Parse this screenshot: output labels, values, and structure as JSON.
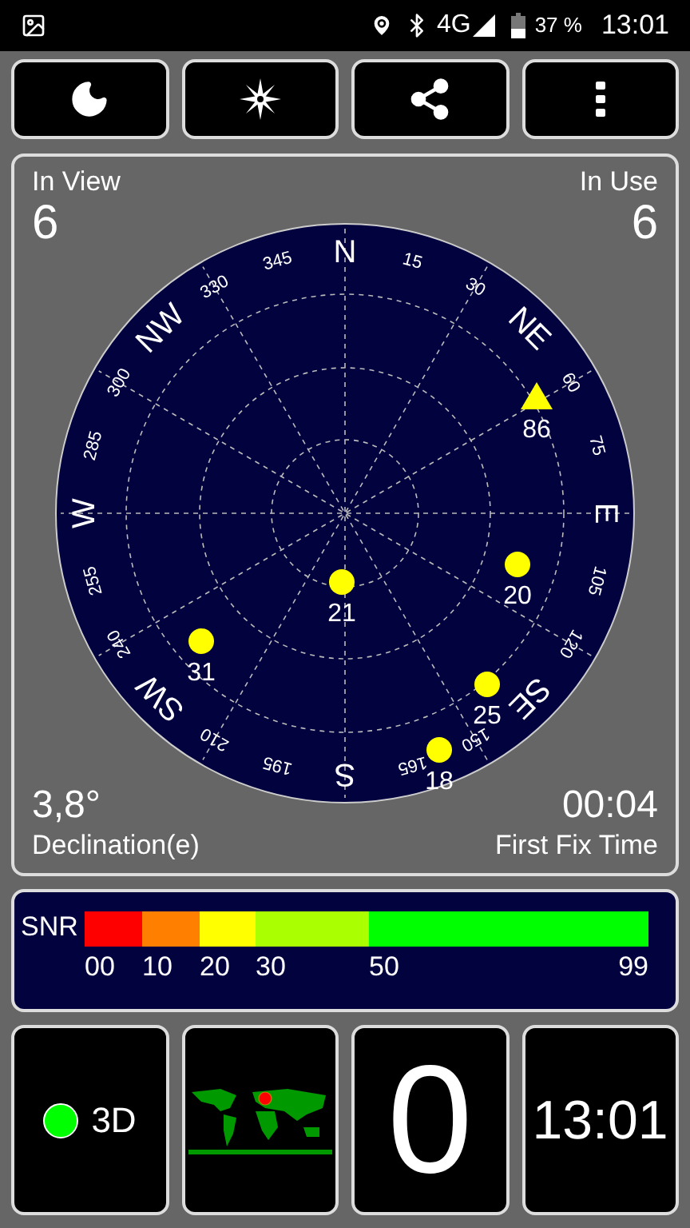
{
  "status_bar": {
    "network": "4G",
    "battery": "37 %",
    "time": "13:01"
  },
  "sky": {
    "in_view_label": "In View",
    "in_view": "6",
    "in_use_label": "In Use",
    "in_use": "6",
    "declination": "3,8°",
    "declination_label": "Declination(e)",
    "fix_time": "00:04",
    "fix_time_label": "First Fix Time",
    "compass": [
      "N",
      "NE",
      "E",
      "SE",
      "S",
      "SW",
      "W",
      "NW"
    ],
    "degrees": [
      "15",
      "30",
      "60",
      "75",
      "105",
      "120",
      "150",
      "165",
      "195",
      "210",
      "240",
      "255",
      "285",
      "300",
      "330",
      "345"
    ],
    "satellites": [
      {
        "id": "86",
        "kind": "triangle"
      },
      {
        "id": "20",
        "kind": "circle"
      },
      {
        "id": "21",
        "kind": "circle"
      },
      {
        "id": "31",
        "kind": "circle"
      },
      {
        "id": "25",
        "kind": "circle"
      },
      {
        "id": "18",
        "kind": "circle"
      }
    ]
  },
  "snr": {
    "label": "SNR",
    "segments": [
      {
        "label": "00",
        "color": "#ff0000"
      },
      {
        "label": "10",
        "color": "#ff8000"
      },
      {
        "label": "20",
        "color": "#ffff00"
      },
      {
        "label": "30",
        "color": "#aaff00"
      },
      {
        "label": "50",
        "color": "#00ff00"
      }
    ],
    "end_label": "99"
  },
  "fix": {
    "label": "3D",
    "color": "#00ff00"
  },
  "satellites_count": "0",
  "clock": "13:01"
}
